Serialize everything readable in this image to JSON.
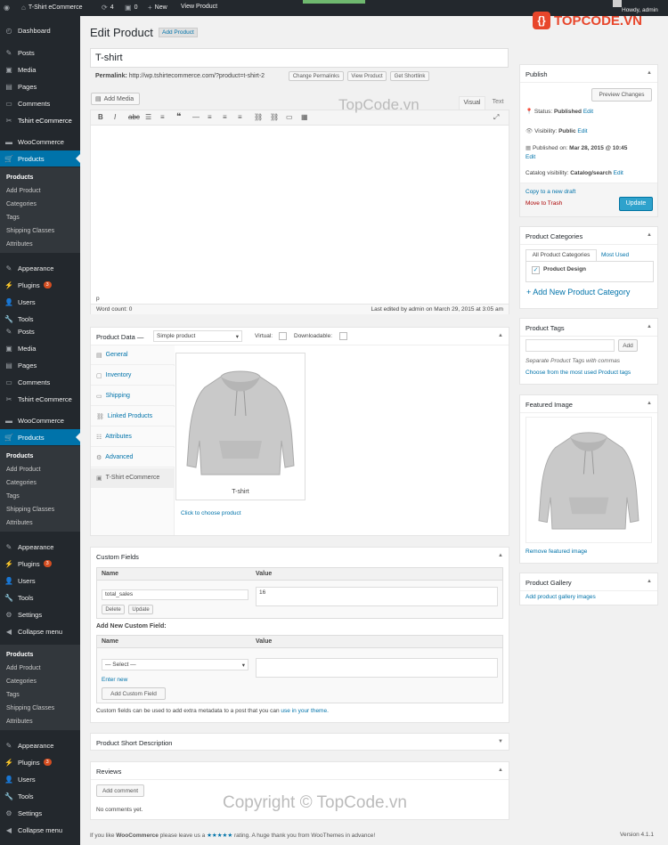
{
  "adminbar": {
    "site": "T-Shirt eCommerce",
    "updates": "4",
    "comments": "0",
    "new": "New",
    "view": "View Product",
    "howdy": "Howdy, admin"
  },
  "sidebar": {
    "menu1": [
      {
        "label": "Dashboard",
        "icon": "dashboard-icon"
      }
    ],
    "menu2": [
      {
        "label": "Posts",
        "icon": "pin-icon"
      },
      {
        "label": "Media",
        "icon": "media-icon"
      },
      {
        "label": "Pages",
        "icon": "page-icon"
      },
      {
        "label": "Comments",
        "icon": "comment-icon"
      },
      {
        "label": "Tshirt eCommerce",
        "icon": "tshirt-icon"
      }
    ],
    "woo": "WooCommerce",
    "products": "Products",
    "sub": [
      "Products",
      "Add Product",
      "Categories",
      "Tags",
      "Shipping Classes",
      "Attributes"
    ],
    "menu3": [
      {
        "label": "Appearance"
      },
      {
        "label": "Plugins",
        "badge": "3"
      },
      {
        "label": "Users"
      },
      {
        "label": "Tools"
      }
    ],
    "menu3b": [
      {
        "label": "Appearance"
      },
      {
        "label": "Plugins",
        "badge": "3"
      },
      {
        "label": "Users"
      },
      {
        "label": "Tools"
      },
      {
        "label": "Settings"
      }
    ],
    "collapse": "Collapse menu",
    "posts2": [
      "Posts",
      "Media",
      "Pages",
      "Comments",
      "Tshirt eCommerce"
    ]
  },
  "page": {
    "title": "Edit Product",
    "add_new": "Add Product",
    "product_title": "T-shirt",
    "permalink_label": "Permalink:",
    "permalink_url": "http://wp.tshirtecommerce.com/?product=t-shirt-2",
    "change_permalinks": "Change Permalinks",
    "view_product": "View Product",
    "get_shortlink": "Get Shortlink"
  },
  "editor": {
    "add_media": "Add Media",
    "tab_visual": "Visual",
    "tab_text": "Text",
    "path": "p",
    "word_count": "Word count: 0",
    "last_edited": "Last edited by admin on March 29, 2015 at 3:05 am"
  },
  "product_data": {
    "label": "Product Data —",
    "type": "Simple product",
    "virtual": "Virtual:",
    "downloadable": "Downloadable:",
    "tabs": [
      "General",
      "Inventory",
      "Shipping",
      "Linked Products",
      "Attributes",
      "Advanced",
      "T-Shirt eCommerce"
    ],
    "tshirt_caption": "T-shirt",
    "choose": "Click to choose product"
  },
  "custom_fields": {
    "title": "Custom Fields",
    "col_name": "Name",
    "col_value": "Value",
    "name_value": "total_sales",
    "value_value": "16",
    "delete": "Delete",
    "update": "Update",
    "add_new_title": "Add New Custom Field:",
    "select": "— Select —",
    "enter_new": "Enter new",
    "add_button": "Add Custom Field",
    "note": "Custom fields can be used to add extra metadata to a post that you can",
    "note_link": "use in your theme."
  },
  "short_desc": {
    "title": "Product Short Description"
  },
  "reviews": {
    "title": "Reviews",
    "add_comment": "Add comment",
    "none": "No comments yet."
  },
  "publish": {
    "title": "Publish",
    "preview": "Preview Changes",
    "status_label": "Status:",
    "status": "Published",
    "edit": "Edit",
    "visibility_label": "Visibility:",
    "visibility": "Public",
    "published_on": "Published on:",
    "date": "Mar 28, 2015 @ 10:45",
    "catalog_label": "Catalog visibility:",
    "catalog": "Catalog/search",
    "copy": "Copy to a new draft",
    "trash": "Move to Trash",
    "update": "Update"
  },
  "categories": {
    "title": "Product Categories",
    "tab_all": "All Product Categories",
    "tab_most": "Most Used",
    "item": "Product Design",
    "add": "+ Add New Product Category"
  },
  "tags": {
    "title": "Product Tags",
    "add": "Add",
    "hint": "Separate Product Tags with commas",
    "choose": "Choose from the most used Product tags"
  },
  "featured": {
    "title": "Featured Image",
    "remove": "Remove featured image"
  },
  "gallery": {
    "title": "Product Gallery",
    "add": "Add product gallery images"
  },
  "footer": {
    "left_a": "If you like",
    "left_b": "WooCommerce",
    "left_c": "please leave us a",
    "stars": "★★★★★",
    "left_d": "rating. A huge thank you from WooThemes in advance!",
    "version": "Version 4.1.1"
  },
  "watermark": {
    "logo": "TOPCODE.VN",
    "mid": "TopCode.vn",
    "bottom": "Copyright © TopCode.vn"
  },
  "colors": {
    "sidebar": "#23282d",
    "accent": "#0073aa",
    "bg": "#f1f1f1"
  }
}
